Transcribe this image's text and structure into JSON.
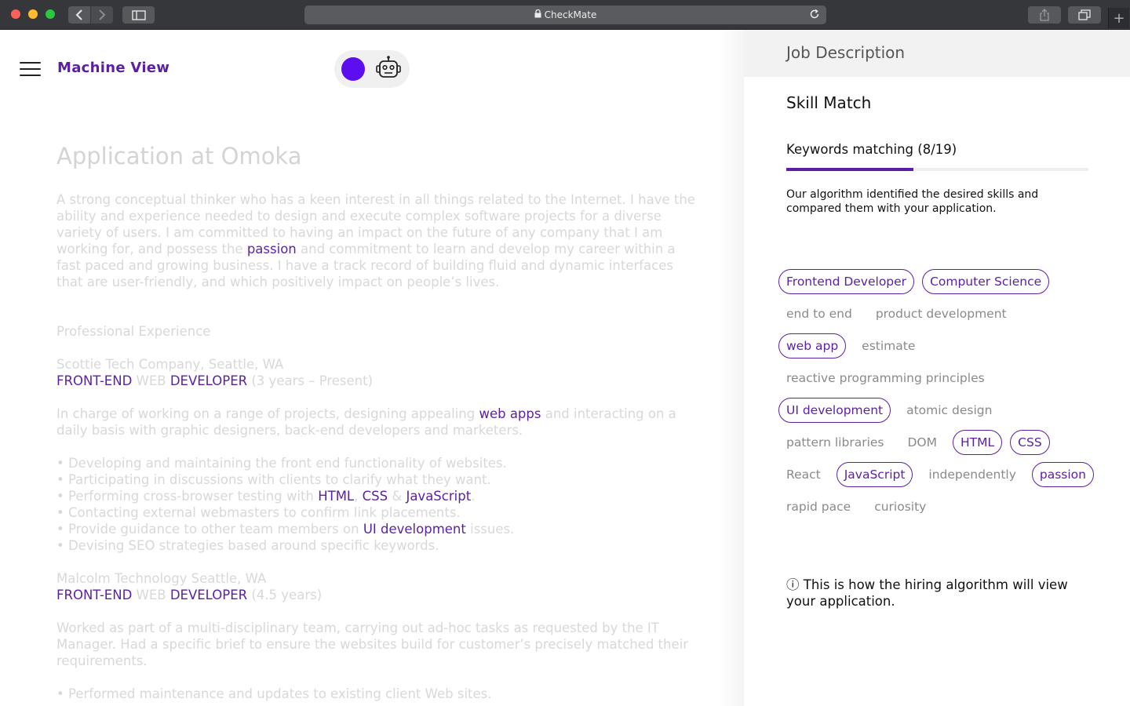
{
  "browser": {
    "url_title": "CheckMate"
  },
  "header": {
    "brand": "Machine View"
  },
  "document": {
    "title": "Application at Omoka",
    "summary": {
      "before": "A strong conceptual thinker who has a keen interest in all things related to the Internet. I have the ability and experience needed to design and execute complex software projects for a diverse variety of users. I am committed to having an impact on the future of any company that I am working for, and possess the ",
      "keyword": "passion",
      "after": " and commitment to learn and develop my career within a fast paced and growing business. I have a track record of building fluid and dynamic interfaces that are user-friendly, and which positively impact on people’s lives."
    },
    "section_heading": "Professional Experience",
    "job1": {
      "company": "Scottie Tech Company, Seattle, WA",
      "role_kw1": "FRONT-END",
      "role_mid": " WEB ",
      "role_kw2": "DEVELOPER",
      "role_dates": " (3 years – Present)",
      "desc_before": "In charge of working on a range of projects, designing appealing ",
      "desc_kw": "web apps",
      "desc_after": " and interacting on a daily basis with graphic designers, back-end developers and marketers.",
      "bullet1": "• Developing and maintaining the front end functionality of websites.",
      "bullet2": "• Participating in discussions with clients to clarify what they want.",
      "bullet3_before": "• Performing cross-browser testing with ",
      "bullet3_kw1": "HTML",
      "bullet3_sep1": ", ",
      "bullet3_kw2": "CSS",
      "bullet3_sep2": " & ",
      "bullet3_kw3": "JavaScript",
      "bullet3_after": ".",
      "bullet4": "• Contacting external webmasters to confirm link placements.",
      "bullet5_before": "• Provide guidance to other team members on ",
      "bullet5_kw": "UI development",
      "bullet5_after": " issues.",
      "bullet6": "• Devising SEO strategies based around specific keywords."
    },
    "job2": {
      "company": "Malcolm Technology Seattle, WA",
      "role_kw1": "FRONT-END",
      "role_mid": " WEB ",
      "role_kw2": "DEVELOPER",
      "role_dates": " (4.5 years)",
      "desc": "Worked as part of a multi-disciplinary team, carrying out ad-hoc tasks as requested by the IT Manager. Had a specific brief to ensure the websites build for customer’s precisely matched their requirements.",
      "bullet1": "• Performed maintenance and updates to existing client Web sites."
    }
  },
  "panel": {
    "title": "Job Description",
    "skill_title": "Skill Match",
    "keywords_label": "Keywords matching (8/19)",
    "progress_fraction": 0.42,
    "description": "Our algorithm identified the desired skills and compared them with your application.",
    "tags": [
      [
        {
          "label": "Frontend Developer",
          "match": true
        },
        {
          "label": "Computer Science",
          "match": true
        }
      ],
      [
        {
          "label": "end to end",
          "match": false
        },
        {
          "label": "product development",
          "match": false
        }
      ],
      [
        {
          "label": "web app",
          "match": true
        },
        {
          "label": "estimate",
          "match": false
        }
      ],
      [
        {
          "label": "reactive programming principles",
          "match": false
        }
      ],
      [
        {
          "label": "UI development",
          "match": true
        },
        {
          "label": "atomic design",
          "match": false
        }
      ],
      [
        {
          "label": "pattern libraries",
          "match": false
        },
        {
          "label": "DOM",
          "match": false
        },
        {
          "label": "HTML",
          "match": true
        },
        {
          "label": "CSS",
          "match": true
        }
      ],
      [
        {
          "label": "React",
          "match": false
        },
        {
          "label": "JavaScript",
          "match": true
        },
        {
          "label": "independently",
          "match": false
        },
        {
          "label": "passion",
          "match": true
        }
      ],
      [
        {
          "label": "rapid pace",
          "match": false
        },
        {
          "label": "curiosity",
          "match": false
        }
      ]
    ],
    "note_icon": "info-icon",
    "note": "ⓘ This is how the hiring algorithm will view your application."
  },
  "colors": {
    "accent": "#5b1fa5",
    "toggle_knob": "#5c0ef0",
    "muted_text": "#d8d8d8"
  }
}
